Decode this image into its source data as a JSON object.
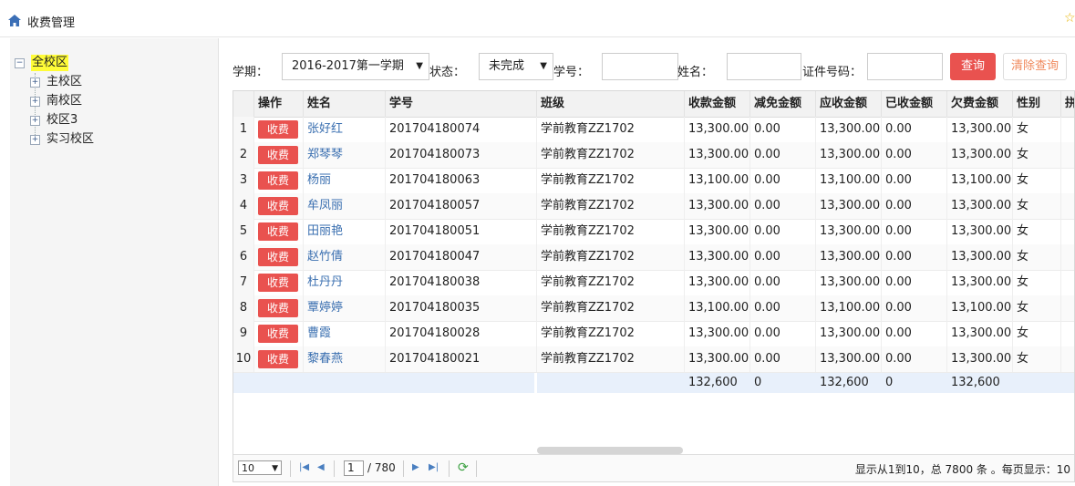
{
  "header": {
    "title": "收费管理"
  },
  "tree": {
    "root": "全校区",
    "children": [
      "主校区",
      "南校区",
      "校区3",
      "实习校区"
    ]
  },
  "filters": {
    "term_label": "学期：",
    "term_value": "2016-2017第一学期",
    "status_label": "状态：",
    "status_value": "未完成",
    "student_no_label": "学号：",
    "name_label": "姓名：",
    "id_label": "证件号码：",
    "query_label": "查询",
    "clear_label": "清除查询"
  },
  "table": {
    "columns": [
      "操作",
      "姓名",
      "学号",
      "班级",
      "收款金额",
      "减免金额",
      "应收金额",
      "已收金额",
      "欠费金额",
      "性别",
      "拼"
    ],
    "action_label": "收费",
    "rows": [
      {
        "num": "1",
        "name": "张好红",
        "student_no": "201704180074",
        "class": "学前教育ZZ1702",
        "receivable": "13,300.00",
        "discount": "0.00",
        "due": "13,300.00",
        "paid": "0.00",
        "owed": "13,300.00",
        "gender": "女"
      },
      {
        "num": "2",
        "name": "郑琴琴",
        "student_no": "201704180073",
        "class": "学前教育ZZ1702",
        "receivable": "13,300.00",
        "discount": "0.00",
        "due": "13,300.00",
        "paid": "0.00",
        "owed": "13,300.00",
        "gender": "女"
      },
      {
        "num": "3",
        "name": "杨丽",
        "student_no": "201704180063",
        "class": "学前教育ZZ1702",
        "receivable": "13,100.00",
        "discount": "0.00",
        "due": "13,100.00",
        "paid": "0.00",
        "owed": "13,100.00",
        "gender": "女"
      },
      {
        "num": "4",
        "name": "牟凤丽",
        "student_no": "201704180057",
        "class": "学前教育ZZ1702",
        "receivable": "13,300.00",
        "discount": "0.00",
        "due": "13,300.00",
        "paid": "0.00",
        "owed": "13,300.00",
        "gender": "女"
      },
      {
        "num": "5",
        "name": "田丽艳",
        "student_no": "201704180051",
        "class": "学前教育ZZ1702",
        "receivable": "13,300.00",
        "discount": "0.00",
        "due": "13,300.00",
        "paid": "0.00",
        "owed": "13,300.00",
        "gender": "女"
      },
      {
        "num": "6",
        "name": "赵竹倩",
        "student_no": "201704180047",
        "class": "学前教育ZZ1702",
        "receivable": "13,300.00",
        "discount": "0.00",
        "due": "13,300.00",
        "paid": "0.00",
        "owed": "13,300.00",
        "gender": "女"
      },
      {
        "num": "7",
        "name": "杜丹丹",
        "student_no": "201704180038",
        "class": "学前教育ZZ1702",
        "receivable": "13,300.00",
        "discount": "0.00",
        "due": "13,300.00",
        "paid": "0.00",
        "owed": "13,300.00",
        "gender": "女"
      },
      {
        "num": "8",
        "name": "覃婷婷",
        "student_no": "201704180035",
        "class": "学前教育ZZ1702",
        "receivable": "13,100.00",
        "discount": "0.00",
        "due": "13,100.00",
        "paid": "0.00",
        "owed": "13,100.00",
        "gender": "女"
      },
      {
        "num": "9",
        "name": "曹霞",
        "student_no": "201704180028",
        "class": "学前教育ZZ1702",
        "receivable": "13,300.00",
        "discount": "0.00",
        "due": "13,300.00",
        "paid": "0.00",
        "owed": "13,300.00",
        "gender": "女"
      },
      {
        "num": "10",
        "name": "黎春燕",
        "student_no": "201704180021",
        "class": "学前教育ZZ1702",
        "receivable": "13,300.00",
        "discount": "0.00",
        "due": "13,300.00",
        "paid": "0.00",
        "owed": "13,300.00",
        "gender": "女"
      }
    ],
    "totals": {
      "receivable": "132,600",
      "discount": "0",
      "due": "132,600",
      "paid": "0",
      "owed": "132,600"
    }
  },
  "pager": {
    "page_size": "10",
    "current_page": "1",
    "total_pages": "/ 780",
    "info": "显示从1到10，总 7800 条 。每页显示：10"
  }
}
